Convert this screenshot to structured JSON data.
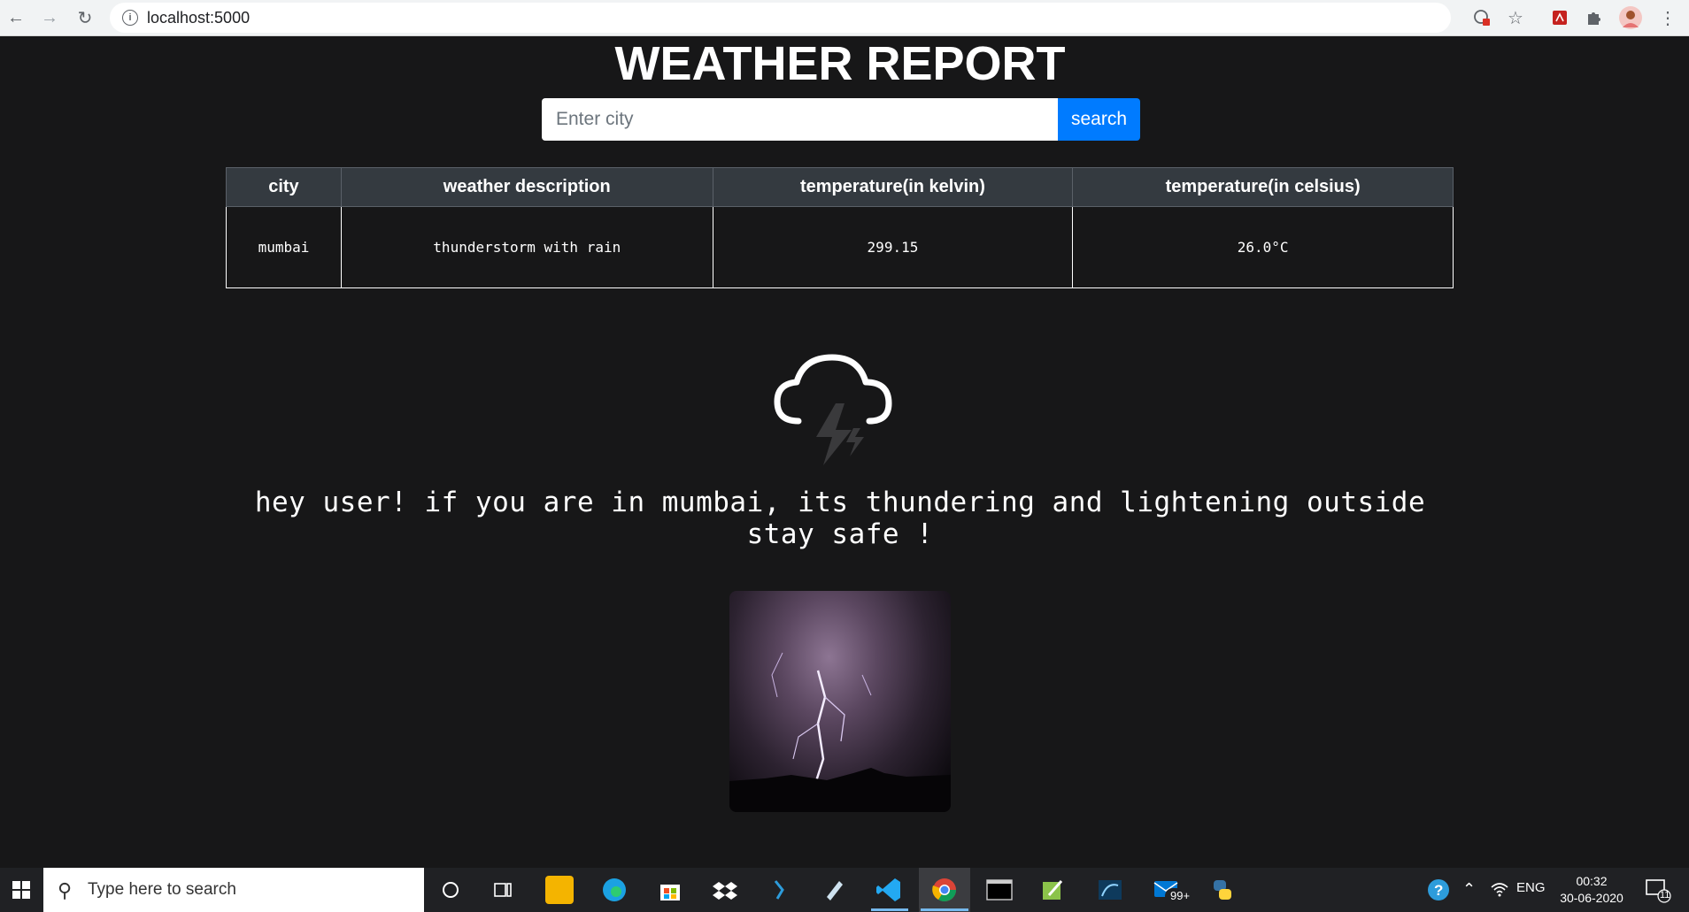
{
  "browser": {
    "url": "localhost:5000",
    "info_icon_glyph": "i",
    "icons": [
      "back-arrow-icon",
      "forward-arrow-icon",
      "reload-icon",
      "info-icon",
      "translate-icon",
      "star-icon",
      "pdf-extension-icon",
      "puzzle-extensions-icon",
      "profile-avatar-icon",
      "kebab-menu-icon"
    ]
  },
  "page": {
    "title": "WEATHER REPORT",
    "search": {
      "placeholder": "Enter city",
      "button_label": "search"
    },
    "table": {
      "headers": [
        "city",
        "weather description",
        "temperature(in kelvin)",
        "temperature(in celsius)"
      ],
      "rows": [
        [
          "mumbai",
          "thunderstorm with rain",
          "299.15",
          "26.0°C"
        ]
      ]
    },
    "weather_icon": "cloud-lightning-icon",
    "message": "hey user! if you are in mumbai, its thundering and lightening outside stay safe !",
    "photo": "lightning-storm-photo"
  },
  "taskbar": {
    "search_placeholder": "Type here to search",
    "apps": [
      "cortana-icon",
      "task-view-icon",
      "file-explorer-icon",
      "edge-icon",
      "store-icon",
      "dropbox-icon",
      "powershell-icon",
      "notepad-icon",
      "vscode-icon",
      "chrome-icon",
      "terminal-icon",
      "notepadplusplus-icon",
      "sql-icon",
      "mail-icon",
      "python-icon"
    ],
    "mail_badge": "99+",
    "tray": {
      "language": "ENG",
      "time": "00:32",
      "date": "30-06-2020",
      "notification_count": "11"
    }
  },
  "colors": {
    "page_bg": "#171718",
    "accent": "#007bff",
    "table_header": "#343a40"
  }
}
